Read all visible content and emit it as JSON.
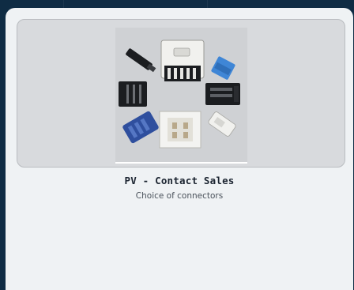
{
  "card": {
    "title": "PV - Contact Sales",
    "subtitle": "Choice of connectors"
  },
  "image": {
    "alt": "Assorted connectors"
  },
  "colors": {
    "page_background": "#0f2c44",
    "card_background": "#eff2f4",
    "image_frame_background": "#d8dadd",
    "connector_blue": "#3f86d6",
    "connector_navy": "#2f4f9e",
    "connector_black": "#1b1d20",
    "connector_white": "#f1f1ee"
  }
}
